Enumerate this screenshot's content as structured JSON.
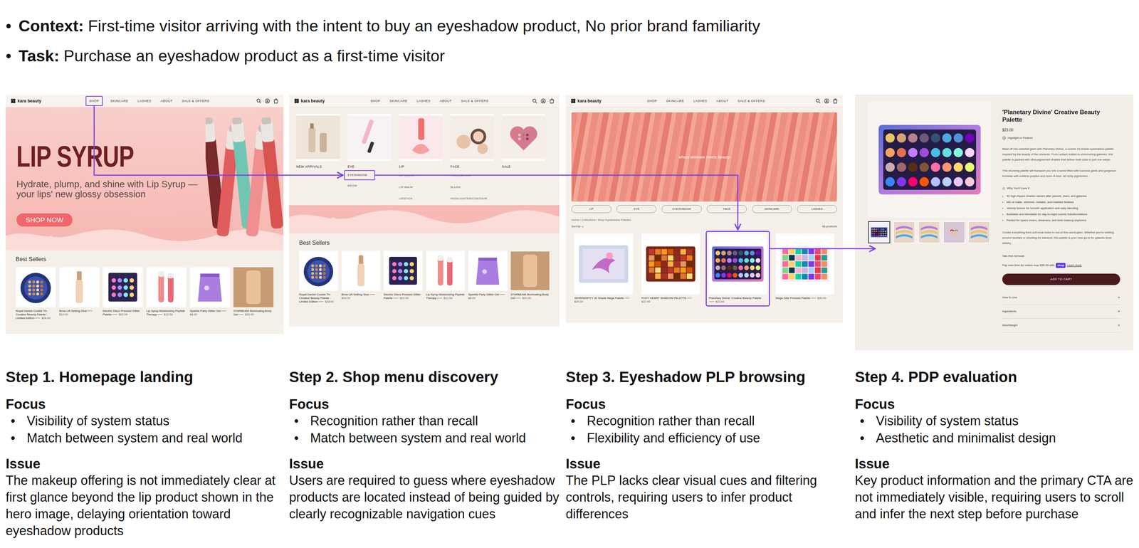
{
  "bullet": "•",
  "brief": [
    {
      "label": "Context:",
      "text": "First-time visitor arriving with the intent to buy an eyeshadow product, No prior brand familiarity"
    },
    {
      "label": "Task:",
      "text": "Purchase an eyeshadow product as a first-time visitor"
    }
  ],
  "screens": {
    "homepage": {
      "logo": "kara beauty",
      "nav": [
        {
          "label": "SHOP",
          "highlighted": true
        },
        {
          "label": "SKINCARE",
          "highlighted": false
        },
        {
          "label": "LASHES",
          "highlighted": false
        },
        {
          "label": "ABOUT",
          "highlighted": false
        },
        {
          "label": "SALE & OFFERS",
          "highlighted": false
        }
      ],
      "hero": {
        "title": "LIP SYRUP",
        "subtitle": "Hydrate, plump, and shine with Lip Syrup — your lips' new glossy obsession",
        "button": "SHOP NOW"
      },
      "best_sellers": {
        "title": "Best Sellers",
        "products": [
          {
            "name": "Royal Danish Cookie Tin Creative Beauty Palette - Limited Edition",
            "price": "$28.00",
            "kind": "tin"
          },
          {
            "name": "Brow Lift Setting Glue",
            "price": "$10.00",
            "kind": "glue"
          },
          {
            "name": "Electric Disco Pressed Glitter Palette",
            "price": "$22.00",
            "kind": "disco"
          },
          {
            "name": "Lip Syrup Moisturizing Peptide Therapy",
            "price": "$12.50",
            "kind": "lipsyrup"
          },
          {
            "name": "Sparkle Party Glitter Gel",
            "price": "$8.00",
            "kind": "pouch"
          },
          {
            "name": "STARBEAM Illuminating Body Gel",
            "price": "$10.00",
            "kind": "bodygel"
          }
        ]
      }
    },
    "shop_menu": {
      "logo": "kara beauty",
      "nav": [
        {
          "label": "SHOP",
          "highlighted": false
        },
        {
          "label": "SKINCARE",
          "highlighted": false
        },
        {
          "label": "LASHES",
          "highlighted": false
        },
        {
          "label": "ABOUT",
          "highlighted": false
        },
        {
          "label": "SALE & OFFERS",
          "highlighted": false
        }
      ],
      "menu": [
        {
          "title": "NEW ARRIVALS",
          "kind": "arrivals",
          "links": []
        },
        {
          "title": "EYE",
          "kind": "eye",
          "links": [
            {
              "label": "EYESHADOW",
              "highlighted": true
            },
            {
              "label": "BROW",
              "highlighted": false
            }
          ]
        },
        {
          "title": "LIP",
          "kind": "lip",
          "links": [
            {
              "label": "LIP GLOSS",
              "highlighted": false
            },
            {
              "label": "LIP BALM",
              "highlighted": false
            },
            {
              "label": "LIPSTICK",
              "highlighted": false
            }
          ]
        },
        {
          "title": "FACE",
          "kind": "face",
          "links": [
            {
              "label": "FOUNDATION",
              "highlighted": false
            },
            {
              "label": "BLUSH",
              "highlighted": false
            },
            {
              "label": "HIGHLIGHTER/CONTOUR",
              "highlighted": false
            }
          ]
        },
        {
          "title": "SALE",
          "kind": "sale",
          "links": []
        }
      ],
      "best_sellers": {
        "title": "Best Sellers",
        "products": [
          {
            "name": "Royal Danish Cookie Tin Creative Beauty Palette - Limited Edition",
            "price": "$28.00",
            "kind": "tin"
          },
          {
            "name": "Brow Lift Setting Glue",
            "price": "$10.00",
            "kind": "glue"
          },
          {
            "name": "Electric Disco Pressed Glitter Palette",
            "price": "$22.00",
            "kind": "disco"
          },
          {
            "name": "Lip Syrup Moisturizing Peptide Therapy",
            "price": "$12.50",
            "kind": "lipsyrup"
          },
          {
            "name": "Sparkle Party Glitter Gel",
            "price": "$8.00",
            "kind": "pouch"
          },
          {
            "name": "STARBEAM Illuminating Body Gel",
            "price": "$10.00",
            "kind": "bodygel"
          }
        ]
      }
    },
    "plp": {
      "logo": "kara beauty",
      "nav": [
        {
          "label": "SHOP",
          "highlighted": false
        },
        {
          "label": "SKINCARE",
          "highlighted": false
        },
        {
          "label": "LASHES",
          "highlighted": false
        },
        {
          "label": "ABOUT",
          "highlighted": false
        },
        {
          "label": "SALE & OFFERS",
          "highlighted": false
        }
      ],
      "banner": "where skincare meets beauty",
      "chips": [
        "LIP",
        "EYE",
        "EYESHADOW",
        "FACE",
        "SKINCARE",
        "LASHES"
      ],
      "breadcrumb": "Home / Collections / Shop Eyeshadow Palettes",
      "sort": "Sort by",
      "count": "56 products",
      "products": [
        {
          "name": "SERENDIPITY 42 Shade Mega Palette",
          "price": "$29.00",
          "kind": "serendipity",
          "highlighted": false
        },
        {
          "name": "FOXY HEART SHADOW PALETTE",
          "price": "$22.99",
          "kind": "foxy",
          "highlighted": false
        },
        {
          "name": "'Planetary Divine' Creative Beauty Palette",
          "price": "$23.00",
          "kind": "planetary",
          "highlighted": true
        },
        {
          "name": "Mega Glitz Pressed Palette",
          "price": "$30.00",
          "kind": "glitz",
          "highlighted": false
        }
      ]
    },
    "pdp": {
      "title": "'Planetary Divine' Creative Beauty Palette",
      "price": "$23.00",
      "feature": "Highlight or Feature",
      "description": [
        "Blast off into celestial glam with Planetary Divine, a cosmic 32-shade eyeshadow palette inspired by the beauty of the universe. From radiant mattes to shimmering galaxies, this palette is packed with ultra-pigmented shades that deliver bold color in just one swipe.",
        "This stunning palette will transport you into a world filled with luscious golds and gorgeous fuchsias with sublime purples and hues of blue, all richly pigmented."
      ],
      "love_title": "Why You'll Love It",
      "love": [
        "32 high-impact shades named after planets, stars, and galaxies",
        "Mix of matte, shimmer, metallic, and marbled finishes",
        "Velvety texture for smooth application and easy blending",
        "Buildable and blendable for day-to-night cosmic transformations",
        "Perfect for space lovers, dreamers, and bold makeup explorers"
      ],
      "outro": "Create everything from soft lunar looks to out-of-this-world glam. Whether you're orbiting around neutrals or shooting for stardust, this palette is your new go-to for galactic-level artistry.",
      "note": "Talc-free formula!",
      "pay": {
        "text": "Pay over time for orders over $35.00 with",
        "badge": "shop",
        "link": "Learn more"
      },
      "cta": "ADD TO CART",
      "accordions": [
        {
          "label": "How to Use",
          "icon": "+"
        },
        {
          "label": "Ingredients",
          "icon": "+"
        },
        {
          "label": "Size/Weight",
          "icon": "+"
        }
      ],
      "thumbs": [
        {
          "selected": true,
          "kind": "palette"
        },
        {
          "selected": false,
          "kind": "swatch"
        },
        {
          "selected": false,
          "kind": "swatch"
        },
        {
          "selected": false,
          "kind": "model"
        },
        {
          "selected": false,
          "kind": "swatch"
        }
      ]
    }
  },
  "steps": [
    {
      "title": "Step 1. Homepage landing",
      "focus_label": "Focus",
      "focus": [
        "Visibility of system status",
        "Match between system and real world"
      ],
      "issue_label": "Issue",
      "issue": "The makeup offering is not immediately clear at first glance beyond the lip product shown in the hero image, delaying orientation toward eyeshadow products"
    },
    {
      "title": "Step 2. Shop menu discovery",
      "focus_label": "Focus",
      "focus": [
        "Recognition rather than recall",
        "Match between system and real world"
      ],
      "issue_label": "Issue",
      "issue": "Users are required to guess where eyeshadow products are located instead of being guided by clearly recognizable navigation cues"
    },
    {
      "title": "Step 3. Eyeshadow PLP browsing",
      "focus_label": "Focus",
      "focus": [
        "Recognition rather than recall",
        "Flexibility and efficiency of use"
      ],
      "issue_label": "Issue",
      "issue": "The PLP lacks clear visual cues and filtering controls, requiring users to infer product differences"
    },
    {
      "title": "Step 4. PDP evaluation",
      "focus_label": "Focus",
      "focus": [
        "Visibility of system status",
        "Aesthetic and minimalist design"
      ],
      "issue_label": "Issue",
      "issue": "Key product information and the primary CTA are not immediately visible, requiring users to scroll and infer the next step before purchase"
    }
  ]
}
